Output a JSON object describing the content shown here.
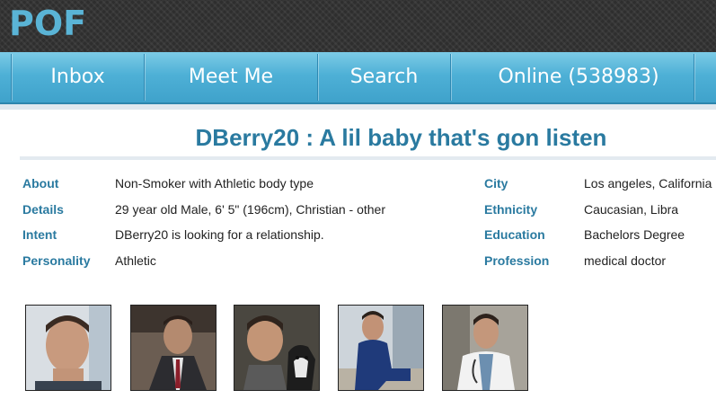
{
  "app": {
    "logo": "POF"
  },
  "nav": {
    "items": [
      {
        "label": "Inbox"
      },
      {
        "label": "Meet Me"
      },
      {
        "label": "Search"
      },
      {
        "label": "Online (538983)"
      }
    ]
  },
  "profile": {
    "headline": "DBerry20 : A lil baby that's gon listen",
    "left": [
      {
        "label": "About",
        "value": "Non-Smoker with Athletic body type"
      },
      {
        "label": "Details",
        "value": "29 year old Male, 6' 5\" (196cm), Christian - other"
      },
      {
        "label": "Intent",
        "value": "DBerry20 is looking for a relationship."
      },
      {
        "label": "Personality",
        "value": "Athletic"
      }
    ],
    "right": [
      {
        "label": "City",
        "value": "Los angeles, California"
      },
      {
        "label": "Ethnicity",
        "value": "Caucasian, Libra"
      },
      {
        "label": "Education",
        "value": "Bachelors Degree"
      },
      {
        "label": "Profession",
        "value": "medical doctor"
      }
    ]
  },
  "photos": [
    {
      "subject": "selfie-closeup"
    },
    {
      "subject": "suit-and-tie"
    },
    {
      "subject": "with-dog"
    },
    {
      "subject": "scrubs-seated"
    },
    {
      "subject": "white-coat"
    }
  ]
}
